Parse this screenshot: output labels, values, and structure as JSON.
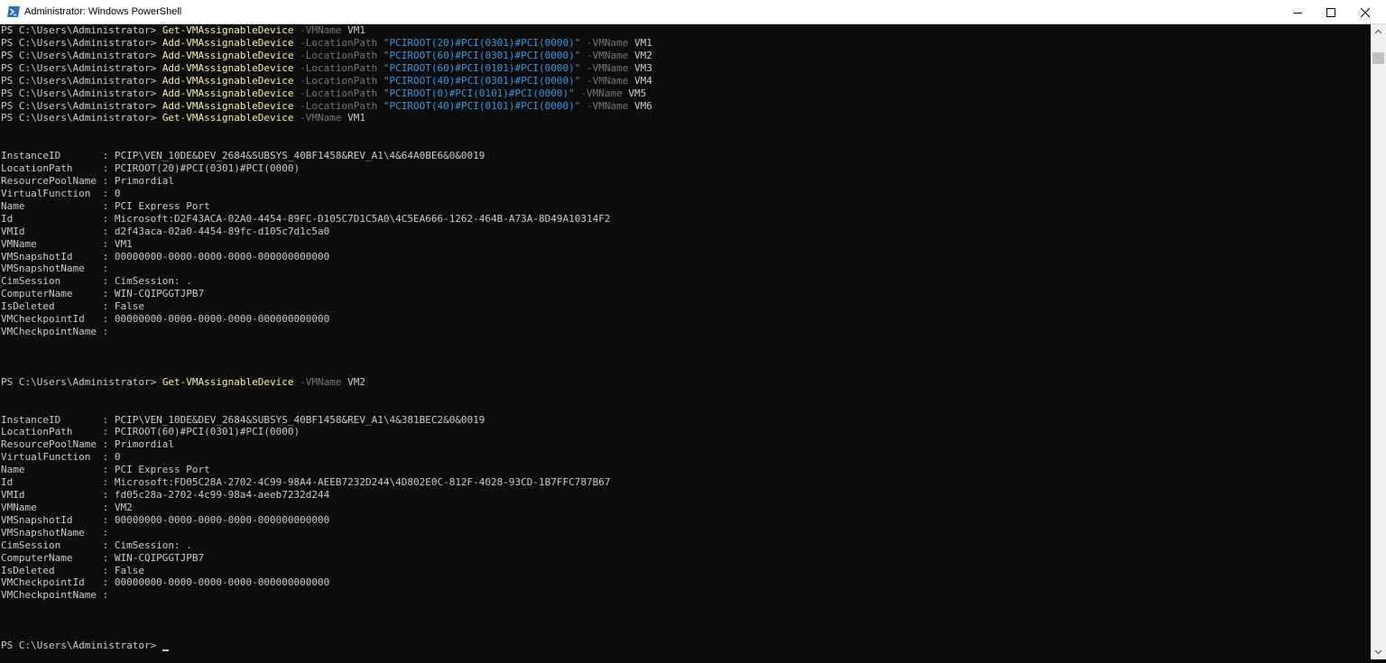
{
  "window": {
    "title": "Administrator: Windows PowerShell",
    "icon": "powershell-icon",
    "controls": [
      "minimize-icon",
      "maximize-icon",
      "close-icon"
    ]
  },
  "colors": {
    "background": "#0c0c0c",
    "text": "#cccccc",
    "command": "#f9f1a5",
    "parameter": "#767676",
    "string": "#3a96dd"
  },
  "prompt": "PS C:\\Users\\Administrator> ",
  "console_lines": [
    [
      {
        "t": "PS C:\\Users\\Administrator> "
      },
      {
        "t": "Get-VMAssignableDevice",
        "c": "cmd"
      },
      {
        "t": " -VMName",
        "c": "param"
      },
      {
        "t": " VM1"
      }
    ],
    [
      {
        "t": "PS C:\\Users\\Administrator> "
      },
      {
        "t": "Add-VMAssignableDevice",
        "c": "cmd"
      },
      {
        "t": " -LocationPath",
        "c": "param"
      },
      {
        "t": " \"PCIROOT(20)#PCI(0301)#PCI(0000)\"",
        "c": "str"
      },
      {
        "t": " -VMName",
        "c": "param"
      },
      {
        "t": " VM1"
      }
    ],
    [
      {
        "t": "PS C:\\Users\\Administrator> "
      },
      {
        "t": "Add-VMAssignableDevice",
        "c": "cmd"
      },
      {
        "t": " -LocationPath",
        "c": "param"
      },
      {
        "t": " \"PCIROOT(60)#PCI(0301)#PCI(0000)\"",
        "c": "str"
      },
      {
        "t": " -VMName",
        "c": "param"
      },
      {
        "t": " VM2"
      }
    ],
    [
      {
        "t": "PS C:\\Users\\Administrator> "
      },
      {
        "t": "Add-VMAssignableDevice",
        "c": "cmd"
      },
      {
        "t": " -LocationPath",
        "c": "param"
      },
      {
        "t": " \"PCIROOT(60)#PCI(0101)#PCI(0000)\"",
        "c": "str"
      },
      {
        "t": " -VMName",
        "c": "param"
      },
      {
        "t": " VM3"
      }
    ],
    [
      {
        "t": "PS C:\\Users\\Administrator> "
      },
      {
        "t": "Add-VMAssignableDevice",
        "c": "cmd"
      },
      {
        "t": " -LocationPath",
        "c": "param"
      },
      {
        "t": " \"PCIROOT(40)#PCI(0301)#PCI(0000)\"",
        "c": "str"
      },
      {
        "t": " -VMName",
        "c": "param"
      },
      {
        "t": " VM4"
      }
    ],
    [
      {
        "t": "PS C:\\Users\\Administrator> "
      },
      {
        "t": "Add-VMAssignableDevice",
        "c": "cmd"
      },
      {
        "t": " -LocationPath",
        "c": "param"
      },
      {
        "t": " \"PCIROOT(0)#PCI(0101)#PCI(0000)\"",
        "c": "str"
      },
      {
        "t": " -VMName",
        "c": "param"
      },
      {
        "t": " VM5"
      }
    ],
    [
      {
        "t": "PS C:\\Users\\Administrator> "
      },
      {
        "t": "Add-VMAssignableDevice",
        "c": "cmd"
      },
      {
        "t": " -LocationPath",
        "c": "param"
      },
      {
        "t": " \"PCIROOT(40)#PCI(0101)#PCI(0000)\"",
        "c": "str"
      },
      {
        "t": " -VMName",
        "c": "param"
      },
      {
        "t": " VM6"
      }
    ],
    [
      {
        "t": "PS C:\\Users\\Administrator> "
      },
      {
        "t": "Get-VMAssignableDevice",
        "c": "cmd"
      },
      {
        "t": " -VMName",
        "c": "param"
      },
      {
        "t": " VM1"
      }
    ],
    [],
    [],
    [
      {
        "t": "InstanceID       : PCIP\\VEN_10DE&DEV_2684&SUBSYS_40BF1458&REV_A1\\4&64A0BE6&0&0019"
      }
    ],
    [
      {
        "t": "LocationPath     : PCIROOT(20)#PCI(0301)#PCI(0000)"
      }
    ],
    [
      {
        "t": "ResourcePoolName : Primordial"
      }
    ],
    [
      {
        "t": "VirtualFunction  : 0"
      }
    ],
    [
      {
        "t": "Name             : PCI Express Port"
      }
    ],
    [
      {
        "t": "Id               : Microsoft:D2F43ACA-02A0-4454-89FC-D105C7D1C5A0\\4C5EA666-1262-464B-A73A-8D49A10314F2"
      }
    ],
    [
      {
        "t": "VMId             : d2f43aca-02a0-4454-89fc-d105c7d1c5a0"
      }
    ],
    [
      {
        "t": "VMName           : VM1"
      }
    ],
    [
      {
        "t": "VMSnapshotId     : 00000000-0000-0000-0000-000000000000"
      }
    ],
    [
      {
        "t": "VMSnapshotName   :"
      }
    ],
    [
      {
        "t": "CimSession       : CimSession: ."
      }
    ],
    [
      {
        "t": "ComputerName     : WIN-CQIPGGTJPB7"
      }
    ],
    [
      {
        "t": "IsDeleted        : False"
      }
    ],
    [
      {
        "t": "VMCheckpointId   : 00000000-0000-0000-0000-000000000000"
      }
    ],
    [
      {
        "t": "VMCheckpointName :"
      }
    ],
    [],
    [],
    [],
    [
      {
        "t": "PS C:\\Users\\Administrator> "
      },
      {
        "t": "Get-VMAssignableDevice",
        "c": "cmd"
      },
      {
        "t": " -VMName",
        "c": "param"
      },
      {
        "t": " VM2"
      }
    ],
    [],
    [],
    [
      {
        "t": "InstanceID       : PCIP\\VEN_10DE&DEV_2684&SUBSYS_40BF1458&REV_A1\\4&381BEC2&0&0019"
      }
    ],
    [
      {
        "t": "LocationPath     : PCIROOT(60)#PCI(0301)#PCI(0000)"
      }
    ],
    [
      {
        "t": "ResourcePoolName : Primordial"
      }
    ],
    [
      {
        "t": "VirtualFunction  : 0"
      }
    ],
    [
      {
        "t": "Name             : PCI Express Port"
      }
    ],
    [
      {
        "t": "Id               : Microsoft:FD05C28A-2702-4C99-98A4-AEEB7232D244\\4D802E0C-812F-4028-93CD-1B7FFC787B67"
      }
    ],
    [
      {
        "t": "VMId             : fd05c28a-2702-4c99-98a4-aeeb7232d244"
      }
    ],
    [
      {
        "t": "VMName           : VM2"
      }
    ],
    [
      {
        "t": "VMSnapshotId     : 00000000-0000-0000-0000-000000000000"
      }
    ],
    [
      {
        "t": "VMSnapshotName   :"
      }
    ],
    [
      {
        "t": "CimSession       : CimSession: ."
      }
    ],
    [
      {
        "t": "ComputerName     : WIN-CQIPGGTJPB7"
      }
    ],
    [
      {
        "t": "IsDeleted        : False"
      }
    ],
    [
      {
        "t": "VMCheckpointId   : 00000000-0000-0000-0000-000000000000"
      }
    ],
    [
      {
        "t": "VMCheckpointName :"
      }
    ],
    [],
    [],
    [],
    [
      {
        "t": "PS C:\\Users\\Administrator> "
      }
    ]
  ]
}
